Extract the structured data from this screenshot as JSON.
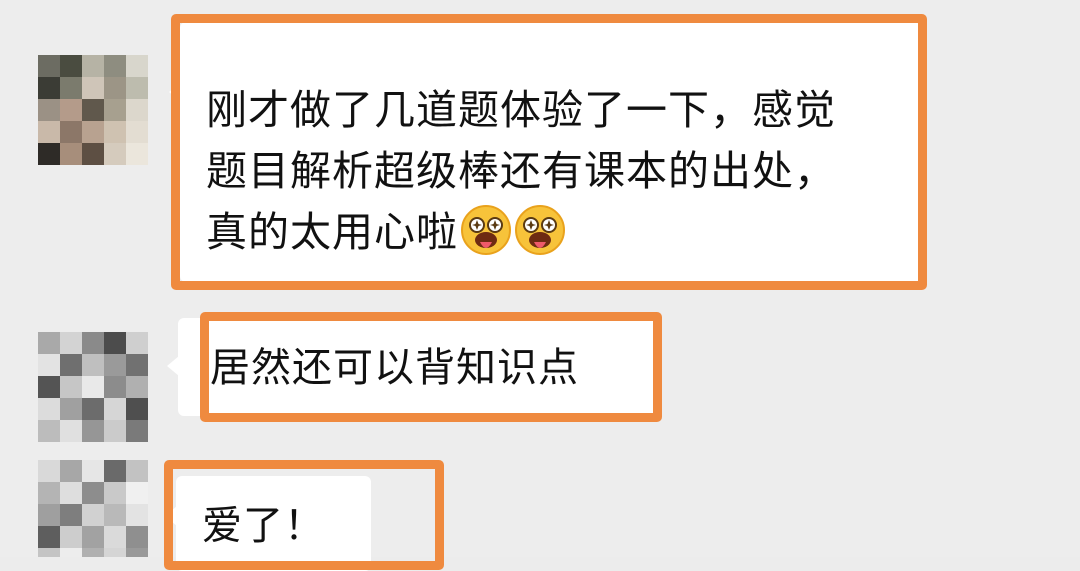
{
  "messages": [
    {
      "text_lines": [
        "刚才做了几道题体验了一下，感觉",
        "题目解析超级棒还有课本的出处，",
        "真的太用心啦"
      ],
      "emoji": [
        "tongue-out-star-eyes-emoji",
        "tongue-out-star-eyes-emoji"
      ]
    },
    {
      "text_lines": [
        "居然还可以背知识点"
      ]
    },
    {
      "text_lines": [
        "爱了！"
      ]
    }
  ],
  "colors": {
    "highlight": "#ef8a3f",
    "bubble": "#ffffff",
    "background": "#ededed"
  }
}
